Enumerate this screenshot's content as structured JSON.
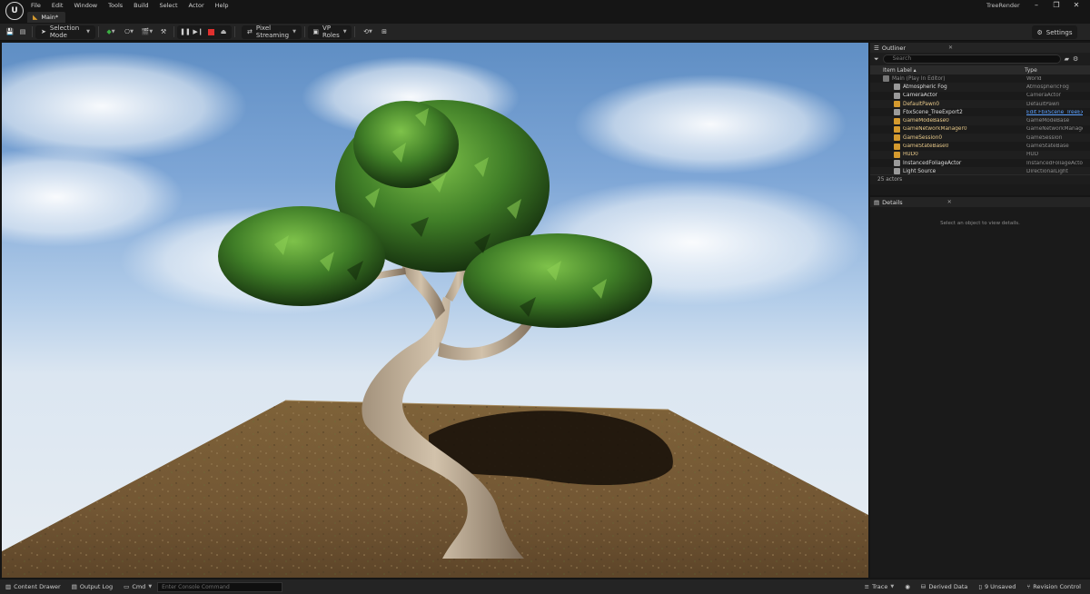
{
  "app": {
    "logo": "U",
    "project_name": "TreeRender",
    "level_tab": "Main*"
  },
  "menu": [
    "File",
    "Edit",
    "Window",
    "Tools",
    "Build",
    "Select",
    "Actor",
    "Help"
  ],
  "toolbar": {
    "selection_mode": "Selection Mode",
    "pixel_streaming": "Pixel Streaming",
    "vp_roles": "VP Roles",
    "settings": "Settings"
  },
  "outliner": {
    "tab": "Outliner",
    "search_placeholder": "Search",
    "col_label": "Item Label ▴",
    "col_type": "Type",
    "rows": [
      {
        "label": "Main (Play In Editor)",
        "type": "World",
        "icon": "world-icon",
        "dim": true
      },
      {
        "label": "Atmospheric Fog",
        "type": "AtmosphericFog",
        "icon": "fog-icon"
      },
      {
        "label": "CameraActor",
        "type": "CameraActor",
        "icon": "camera-icon"
      },
      {
        "label": "DefaultPawn0",
        "type": "DefaultPawn",
        "icon": "pawn-icon"
      },
      {
        "label": "FbxScene_TreeExport2",
        "type": "Edit FbxScene_TreeEx",
        "icon": "scene-icon",
        "link": true
      },
      {
        "label": "GameModeBase0",
        "type": "GameModeBase",
        "icon": "gamemode-icon"
      },
      {
        "label": "GameNetworkManager0",
        "type": "GameNetworkManager",
        "icon": "network-icon"
      },
      {
        "label": "GameSession0",
        "type": "GameSession",
        "icon": "session-icon"
      },
      {
        "label": "GameStateBase0",
        "type": "GameStateBase",
        "icon": "gamestate-icon"
      },
      {
        "label": "HUD0",
        "type": "HUD",
        "icon": "hud-icon"
      },
      {
        "label": "InstancedFoliageActor",
        "type": "InstancedFoliageActor",
        "icon": "foliage-icon"
      },
      {
        "label": "Light Source",
        "type": "DirectionalLight",
        "icon": "light-icon"
      }
    ],
    "actor_count": "25 actors"
  },
  "details": {
    "tab": "Details",
    "empty_text": "Select an object to view details."
  },
  "statusbar": {
    "content_drawer": "Content Drawer",
    "output_log": "Output Log",
    "cmd": "Cmd",
    "console_placeholder": "Enter Console Command",
    "trace": "Trace",
    "derived_data": "Derived Data",
    "unsaved": "9 Unsaved",
    "revision_control": "Revision Control"
  },
  "colors": {
    "accent": "#d59a2e",
    "link": "#5aa0ff",
    "record": "#e0302e",
    "play": "#3cb043"
  }
}
